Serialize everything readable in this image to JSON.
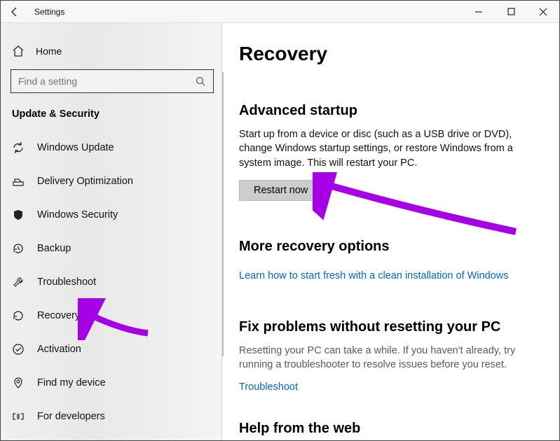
{
  "titlebar": {
    "title": "Settings"
  },
  "sidebar": {
    "home_label": "Home",
    "search_placeholder": "Find a setting",
    "group_label": "Update & Security",
    "items": [
      {
        "label": "Windows Update"
      },
      {
        "label": "Delivery Optimization"
      },
      {
        "label": "Windows Security"
      },
      {
        "label": "Backup"
      },
      {
        "label": "Troubleshoot"
      },
      {
        "label": "Recovery"
      },
      {
        "label": "Activation"
      },
      {
        "label": "Find my device"
      },
      {
        "label": "For developers"
      }
    ]
  },
  "main": {
    "page_title": "Recovery",
    "advanced": {
      "heading": "Advanced startup",
      "body": "Start up from a device or disc (such as a USB drive or DVD), change Windows startup settings, or restore Windows from a system image. This will restart your PC.",
      "button": "Restart now"
    },
    "more": {
      "heading": "More recovery options",
      "link": "Learn how to start fresh with a clean installation of Windows"
    },
    "fix": {
      "heading": "Fix problems without resetting your PC",
      "body": "Resetting your PC can take a while. If you haven't already, try running a troubleshooter to resolve issues before you reset.",
      "link": "Troubleshoot"
    },
    "help": {
      "heading": "Help from the web"
    }
  }
}
